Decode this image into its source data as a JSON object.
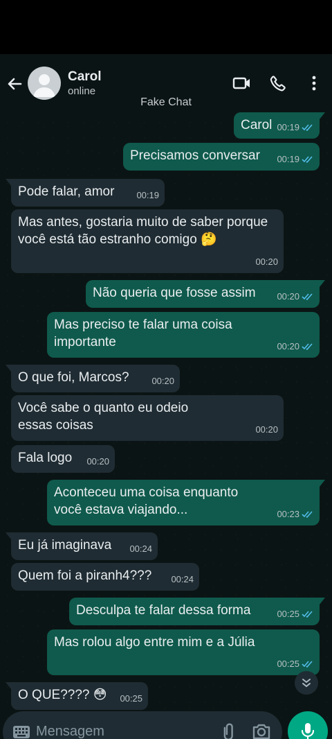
{
  "header": {
    "contact_name": "Carol",
    "status": "online",
    "watermark": "Fake Chat"
  },
  "colors": {
    "incoming": "#1f2c33",
    "outgoing": "#0f5a4c",
    "read_ticks": "#53bdeb",
    "accent": "#00a884"
  },
  "messages": [
    {
      "dir": "out",
      "text": "Carol",
      "time": "00:19",
      "status": "read"
    },
    {
      "dir": "out",
      "text": "Precisamos conversar",
      "time": "00:19",
      "status": "read"
    },
    {
      "dir": "in",
      "text": "Pode falar, amor",
      "time": "00:19"
    },
    {
      "dir": "in",
      "text": "Mas antes, gostaria muito de saber porque você está tão estranho comigo 🤔",
      "time": "00:20"
    },
    {
      "dir": "out",
      "text": "Não queria que fosse assim",
      "time": "00:20",
      "status": "read"
    },
    {
      "dir": "out",
      "text": "Mas preciso te falar uma coisa importante",
      "time": "00:20",
      "status": "read"
    },
    {
      "dir": "in",
      "text": "O que foi, Marcos?",
      "time": "00:20"
    },
    {
      "dir": "in",
      "text": "Você sabe o quanto eu odeio essas coisas",
      "time": "00:20"
    },
    {
      "dir": "in",
      "text": "Fala logo",
      "time": "00:20"
    },
    {
      "dir": "out",
      "text": "Aconteceu uma coisa enquanto você estava viajando...",
      "time": "00:23",
      "status": "read"
    },
    {
      "dir": "in",
      "text": "Eu já imaginava",
      "time": "00:24"
    },
    {
      "dir": "in",
      "text": "Quem foi a piranh4???",
      "time": "00:24"
    },
    {
      "dir": "out",
      "text": "Desculpa te falar dessa forma",
      "time": "00:25",
      "status": "read"
    },
    {
      "dir": "out",
      "text": "Mas rolou algo entre mim e a Júlia",
      "time": "00:25",
      "status": "read"
    },
    {
      "dir": "in",
      "text": "O QUE???? 😳",
      "time": "00:25"
    }
  ],
  "composer": {
    "placeholder": "Mensagem"
  },
  "icons": {
    "back": "arrow-left-icon",
    "video": "video-call-icon",
    "call": "phone-icon",
    "more": "more-vert-icon",
    "keyboard": "keyboard-icon",
    "attach": "paperclip-icon",
    "camera": "camera-icon",
    "mic": "microphone-icon",
    "scroll": "double-chevron-down-icon"
  }
}
